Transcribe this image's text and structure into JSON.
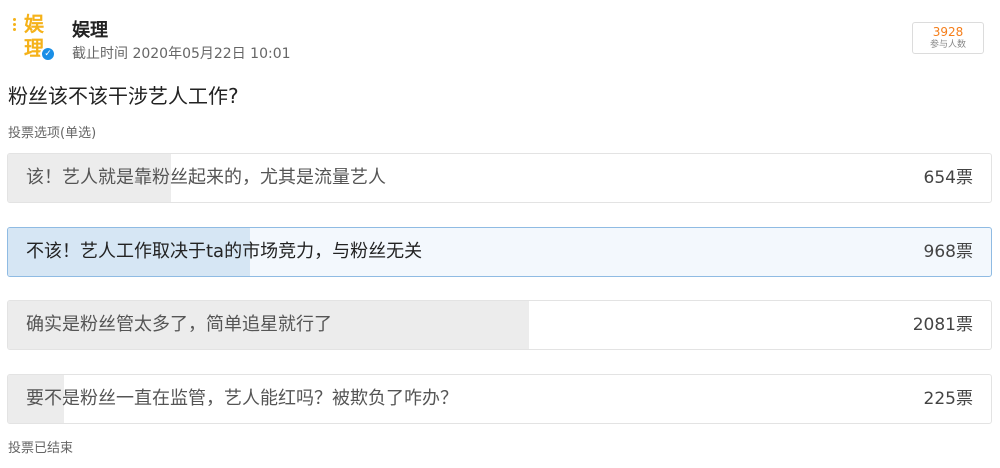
{
  "user": {
    "name": "娱理",
    "avatar_text": "娱理",
    "deadline": "截止时间 2020年05月22日 10:01"
  },
  "participants": {
    "count": "3928",
    "label": "参与人数"
  },
  "poll": {
    "question": "粉丝该不该干涉艺人工作?",
    "type_label": "投票选项(单选)",
    "options": [
      {
        "label": "该！艺人就是靠粉丝起来的，尤其是流量艺人",
        "votes": "654票",
        "share": 0.166,
        "selected": false
      },
      {
        "label": "不该！艺人工作取决于ta的市场竞力，与粉丝无关",
        "votes": "968票",
        "share": 0.246,
        "selected": true
      },
      {
        "label": "确实是粉丝管太多了，简单追星就行了",
        "votes": "2081票",
        "share": 0.53,
        "selected": false
      },
      {
        "label": "要不是粉丝一直在监管，艺人能红吗？被欺负了咋办？",
        "votes": "225票",
        "share": 0.057,
        "selected": false
      }
    ],
    "status": "投票已结束"
  },
  "colors": {
    "accent_count": "#f57e1a",
    "selected_fill": "#d6e6f4",
    "selected_border": "#8fbbe3",
    "bar_fill": "#ececec",
    "verified": "#1a8fe6"
  }
}
